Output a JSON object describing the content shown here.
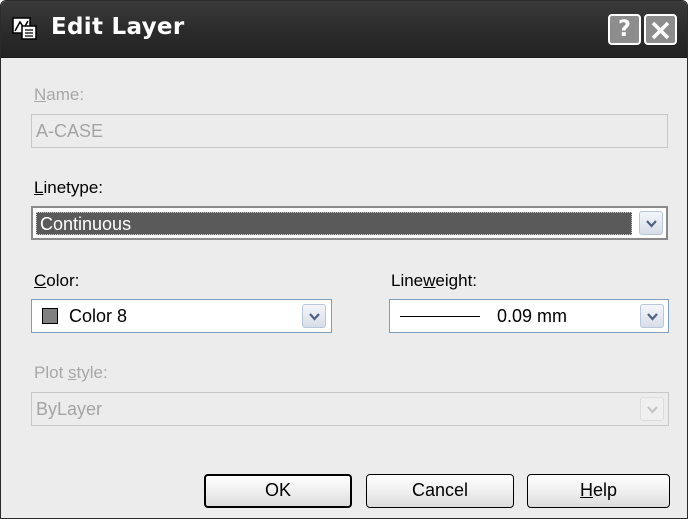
{
  "window": {
    "title": "Edit Layer",
    "help_button": "?"
  },
  "name": {
    "label_u": "N",
    "label_rest": "ame:",
    "value": "A-CASE"
  },
  "linetype": {
    "label_u": "L",
    "label_rest": "inetype:",
    "value": "Continuous"
  },
  "color": {
    "label_u": "C",
    "label_rest": "olor:",
    "value": "Color 8",
    "swatch_color": "#808080"
  },
  "lineweight": {
    "label_pre": "Line",
    "label_u": "w",
    "label_rest": "eight:",
    "value": "0.09 mm"
  },
  "plot_style": {
    "label_pre": "Plot ",
    "label_u": "s",
    "label_rest": "tyle:",
    "value": "ByLayer"
  },
  "buttons": {
    "ok": "OK",
    "cancel": "Cancel",
    "help_u": "H",
    "help_rest": "elp"
  }
}
